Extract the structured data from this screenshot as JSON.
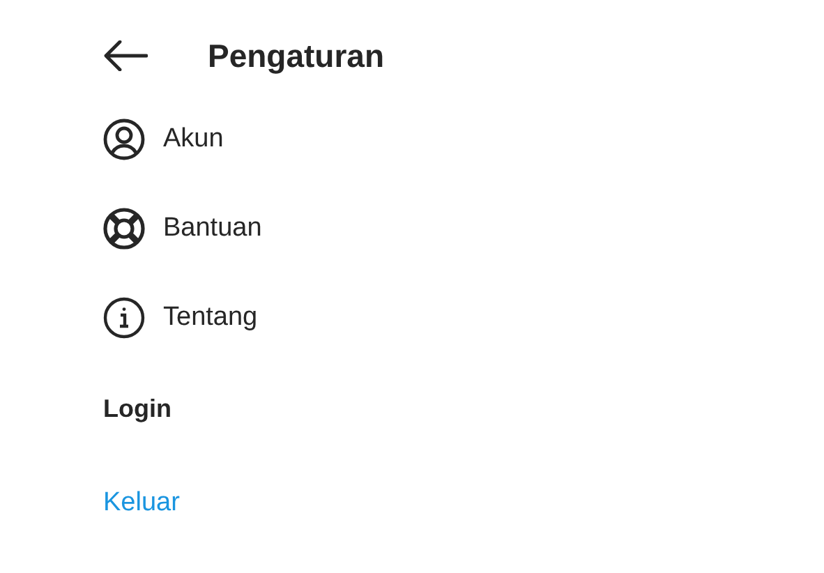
{
  "header": {
    "title": "Pengaturan"
  },
  "items": [
    {
      "kind": "account",
      "label": "Akun"
    },
    {
      "kind": "help",
      "label": "Bantuan"
    },
    {
      "kind": "info",
      "label": "Tentang"
    }
  ],
  "section": {
    "title": "Login"
  },
  "logout": {
    "label": "Keluar"
  }
}
